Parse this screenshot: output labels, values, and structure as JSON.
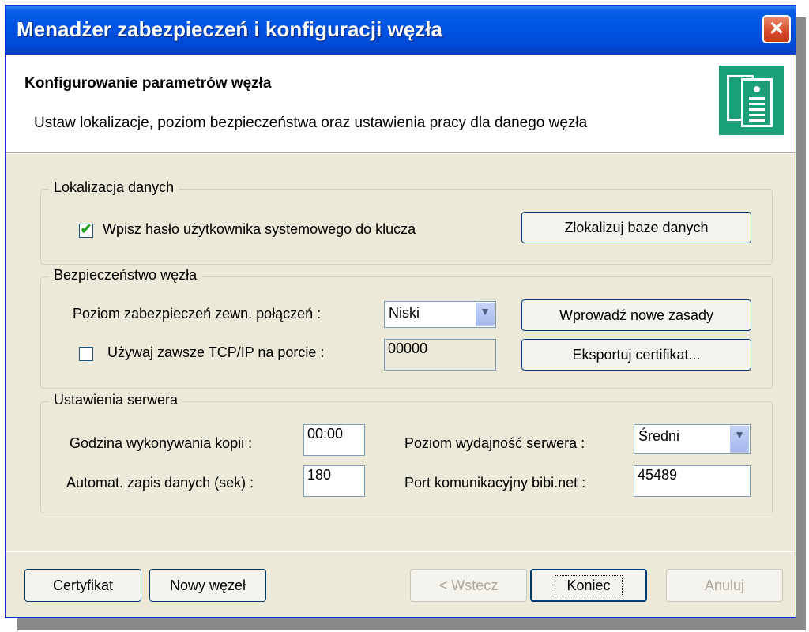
{
  "window": {
    "title": "Menadżer zabezpieczeń i konfiguracji węzła",
    "close_symbol": "✕"
  },
  "header": {
    "title": "Konfigurowanie parametrów węzła",
    "subtitle": "Ustaw lokalizacje, poziom bezpieczeństwa oraz ustawienia pracy dla danego węzła",
    "icon": "document-icon"
  },
  "lokalizacja": {
    "legend": "Lokalizacja danych",
    "checkbox_label": "Wpisz hasło użytkownika systemowego do klucza",
    "checkbox_checked": true,
    "checkmark": "✔",
    "button": "Zlokalizuj baze danych"
  },
  "bezpieczenstwo": {
    "legend": "Bezpieczeństwo węzła",
    "poziom_label": "Poziom zabezpieczeń  zewn. połączeń :",
    "poziom_value": "Niski",
    "tcp_label": "Używaj zawsze TCP/IP na porcie :",
    "tcp_checked": false,
    "tcp_port": "00000",
    "button_zasady": "Wprowadź nowe zasady",
    "button_eksport": "Eksportuj certifikat..."
  },
  "serwer": {
    "legend": "Ustawienia serwera",
    "godzina_label": "Godzina  wykonywania kopii  :",
    "godzina_value": "00:00",
    "zapis_label": "Automat. zapis danych  (sek) :",
    "zapis_value": "180",
    "wydajnosc_label": "Poziom wydajność serwera :",
    "wydajnosc_value": "Średni",
    "port_label": "Port komunikacyjny bibi.net :",
    "port_value": "45489"
  },
  "footer": {
    "certyfikat": "Certyfikat",
    "nowy_wezel": "Nowy węzeł",
    "wstecz": "< Wstecz",
    "koniec": "Koniec",
    "anuluj": "Anuluj"
  },
  "dropdown_arrow": "▼",
  "colors": {
    "titlebar": "#0054e3",
    "accent_green": "#1a9f78",
    "dialog_bg": "#ece9d8"
  }
}
